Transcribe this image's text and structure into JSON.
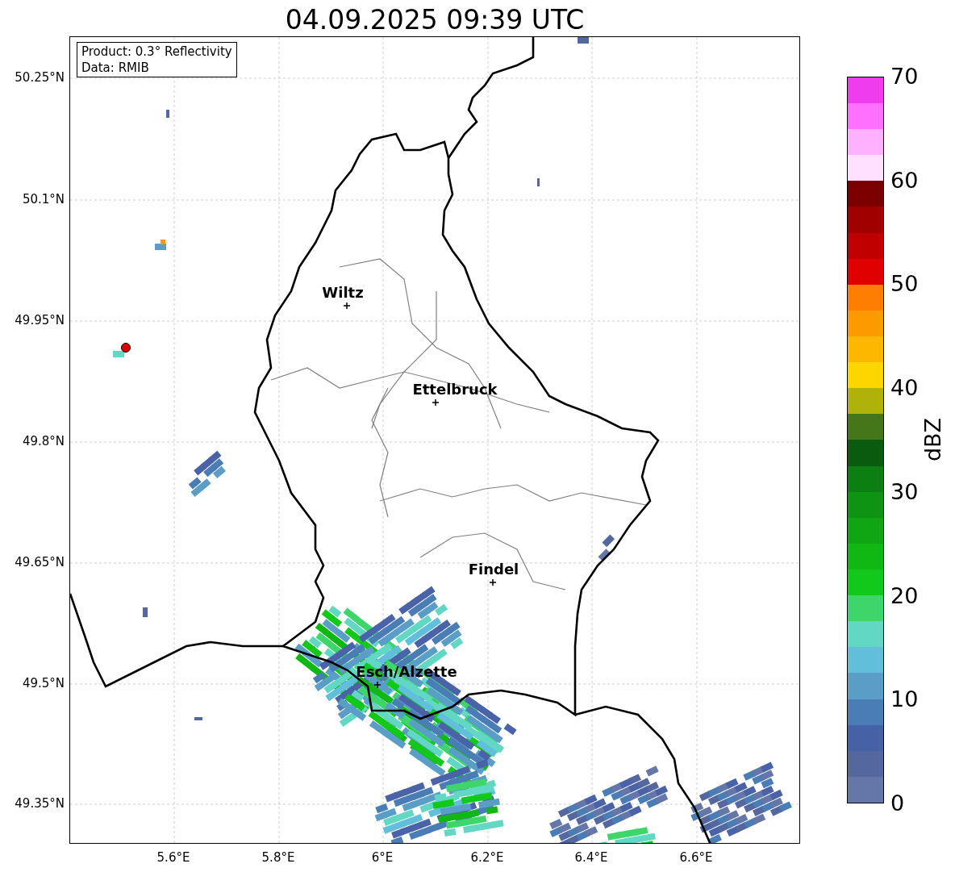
{
  "title": "04.09.2025 09:39 UTC",
  "info_box": [
    "Product: 0.3° Reflectivity",
    "Data: RMIB"
  ],
  "map": {
    "y_ticks": [
      "50.25°N",
      "50.1°N",
      "49.95°N",
      "49.8°N",
      "49.65°N",
      "49.5°N",
      "49.35°N"
    ],
    "x_ticks": [
      "5.6°E",
      "5.8°E",
      "6°E",
      "6.2°E",
      "6.4°E",
      "6.6°E"
    ],
    "cities": [
      {
        "name": "Wiltz"
      },
      {
        "name": "Ettelbruck"
      },
      {
        "name": "Findel"
      },
      {
        "name": "Esch/Alzette"
      }
    ]
  },
  "colorbar": {
    "label": "dBZ",
    "ticks": [
      "70",
      "60",
      "50",
      "40",
      "30",
      "20",
      "10",
      "0"
    ],
    "bins": [
      {
        "color": "#6577a9"
      },
      {
        "color": "#55679f"
      },
      {
        "color": "#4661a5"
      },
      {
        "color": "#4a7db5"
      },
      {
        "color": "#5a9ec8"
      },
      {
        "color": "#62bfdc"
      },
      {
        "color": "#62d8c4"
      },
      {
        "color": "#3ed66b"
      },
      {
        "color": "#12c81a"
      },
      {
        "color": "#11b814"
      },
      {
        "color": "#10a613"
      },
      {
        "color": "#0e9313"
      },
      {
        "color": "#0c7f12"
      },
      {
        "color": "#0a5a0f"
      },
      {
        "color": "#46761a"
      },
      {
        "color": "#afb20b"
      },
      {
        "color": "#fdd600"
      },
      {
        "color": "#fdb700"
      },
      {
        "color": "#fd9a00"
      },
      {
        "color": "#fd7e00"
      },
      {
        "color": "#e00000"
      },
      {
        "color": "#c00000"
      },
      {
        "color": "#a00000"
      },
      {
        "color": "#7c0000"
      },
      {
        "color": "#ffe0ff"
      },
      {
        "color": "#ffb0ff"
      },
      {
        "color": "#ff70ff"
      },
      {
        "color": "#ee3cee"
      }
    ]
  }
}
